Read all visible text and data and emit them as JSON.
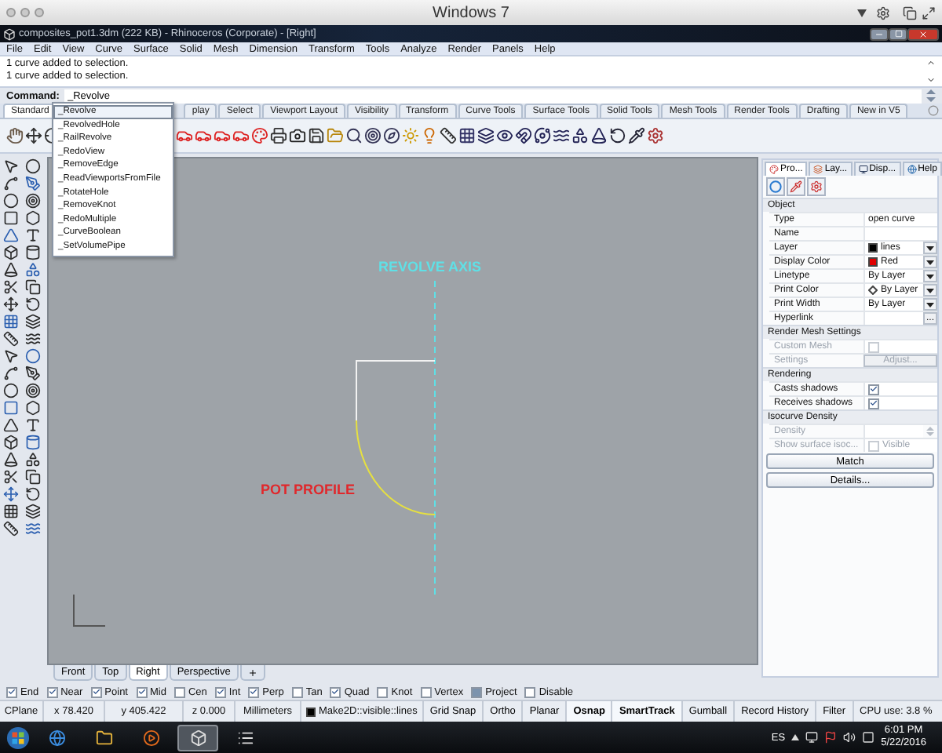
{
  "os_title": "Windows 7",
  "window": {
    "title": "composites_pot1.3dm (222 KB) - Rhinoceros (Corporate) - [Right]"
  },
  "menu": [
    "File",
    "Edit",
    "View",
    "Curve",
    "Surface",
    "Solid",
    "Mesh",
    "Dimension",
    "Transform",
    "Tools",
    "Analyze",
    "Render",
    "Panels",
    "Help"
  ],
  "history": [
    "1 curve added to selection.",
    "1 curve added to selection."
  ],
  "command": {
    "label": "Command:",
    "value": "_Revolve"
  },
  "autocomplete": [
    {
      "label": "_Revolve",
      "selected": true
    },
    {
      "label": "_RevolvedHole",
      "selected": false
    },
    {
      "label": "_RailRevolve",
      "selected": false
    },
    {
      "label": "_RedoView",
      "selected": false
    },
    {
      "label": "_RemoveEdge",
      "selected": false
    },
    {
      "label": "_ReadViewportsFromFile",
      "selected": false
    },
    {
      "label": "_RotateHole",
      "selected": false
    },
    {
      "label": "_RemoveKnot",
      "selected": false
    },
    {
      "label": "_RedoMultiple",
      "selected": false
    },
    {
      "label": "_CurveBoolean",
      "selected": false
    },
    {
      "label": "_SetVolumePipe",
      "selected": false
    }
  ],
  "toolbar_tabs": [
    {
      "label": "Standard",
      "selected": true
    },
    {
      "label": "play",
      "selected": false
    },
    {
      "label": "Select",
      "selected": false
    },
    {
      "label": "Viewport Layout",
      "selected": false
    },
    {
      "label": "Visibility",
      "selected": false
    },
    {
      "label": "Transform",
      "selected": false
    },
    {
      "label": "Curve Tools",
      "selected": false
    },
    {
      "label": "Surface Tools",
      "selected": false
    },
    {
      "label": "Solid Tools",
      "selected": false
    },
    {
      "label": "Mesh Tools",
      "selected": false
    },
    {
      "label": "Render Tools",
      "selected": false
    },
    {
      "label": "Drafting",
      "selected": false
    },
    {
      "label": "New in V5",
      "selected": false
    }
  ],
  "viewport": {
    "axis_label": "REVOLVE AXIS",
    "profile_label": "POT PROFILE"
  },
  "viewport_tabs": [
    {
      "label": "Front",
      "selected": false
    },
    {
      "label": "Top",
      "selected": false
    },
    {
      "label": "Right",
      "selected": true
    },
    {
      "label": "Perspective",
      "selected": false
    }
  ],
  "osnaps": [
    {
      "label": "End",
      "checked": true
    },
    {
      "label": "Near",
      "checked": true
    },
    {
      "label": "Point",
      "checked": true
    },
    {
      "label": "Mid",
      "checked": true
    },
    {
      "label": "Cen",
      "checked": false
    },
    {
      "label": "Int",
      "checked": true
    },
    {
      "label": "Perp",
      "checked": true
    },
    {
      "label": "Tan",
      "checked": false
    },
    {
      "label": "Quad",
      "checked": true
    },
    {
      "label": "Knot",
      "checked": false
    },
    {
      "label": "Vertex",
      "checked": false
    },
    {
      "label": "Project",
      "checked": false,
      "filled": true
    },
    {
      "label": "Disable",
      "checked": false
    }
  ],
  "status": {
    "cplane": "CPlane",
    "x": "x 78.420",
    "y": "y 405.422",
    "z": "z 0.000",
    "units": "Millimeters",
    "layer": "Make2D::visible::lines",
    "toggles": [
      {
        "label": "Grid Snap",
        "on": false
      },
      {
        "label": "Ortho",
        "on": false
      },
      {
        "label": "Planar",
        "on": false
      },
      {
        "label": "Osnap",
        "on": true
      },
      {
        "label": "SmartTrack",
        "on": true
      },
      {
        "label": "Gumball",
        "on": false
      },
      {
        "label": "Record History",
        "on": false
      },
      {
        "label": "Filter",
        "on": false
      }
    ],
    "cpu": "CPU use: 3.8 %"
  },
  "properties": {
    "tabs": [
      {
        "label": "Pro...",
        "selected": true
      },
      {
        "label": "Lay...",
        "selected": false
      },
      {
        "label": "Disp...",
        "selected": false
      },
      {
        "label": "Help",
        "selected": false
      }
    ],
    "sections": [
      {
        "title": "Object",
        "rows": [
          {
            "kind": "text",
            "label": "Type",
            "value": "open curve"
          },
          {
            "kind": "text",
            "label": "Name"
          },
          {
            "kind": "select",
            "label": "Layer",
            "value": "lines",
            "color": "#000000"
          },
          {
            "kind": "select",
            "label": "Display Color",
            "value": "Red",
            "color": "#e00000"
          },
          {
            "kind": "select",
            "label": "Linetype",
            "value": "By Layer"
          },
          {
            "kind": "select",
            "label": "Print Color",
            "value": "By Layer",
            "diamond": true
          },
          {
            "kind": "select",
            "label": "Print Width",
            "value": "By Layer"
          },
          {
            "kind": "dots",
            "label": "Hyperlink",
            "button": "..."
          }
        ]
      },
      {
        "title": "Render Mesh Settings",
        "rows": [
          {
            "kind": "check",
            "label": "Custom Mesh",
            "checked": false,
            "disabled": true
          },
          {
            "kind": "button",
            "label": "Settings",
            "button": "Adjust...",
            "disabled": true
          }
        ]
      },
      {
        "title": "Rendering",
        "rows": [
          {
            "kind": "check",
            "label": "Casts shadows",
            "checked": true,
            "disabled": false
          },
          {
            "kind": "check",
            "label": "Receives shadows",
            "checked": true,
            "disabled": false
          }
        ]
      },
      {
        "title": "Isocurve Density",
        "rows": [
          {
            "kind": "spin",
            "label": "Density",
            "disabled": true
          },
          {
            "kind": "check",
            "label": "Show surface isoc...",
            "checked": false,
            "disabled": true,
            "text": "Visible"
          }
        ]
      }
    ],
    "buttons": [
      "Match",
      "Details..."
    ]
  },
  "taskbar": {
    "apps": [
      {
        "kind": "browser",
        "selected": false
      },
      {
        "kind": "folder",
        "selected": false
      },
      {
        "kind": "media",
        "selected": false
      },
      {
        "kind": "cad",
        "selected": true
      },
      {
        "kind": "list",
        "selected": false
      }
    ],
    "language": "ES",
    "time": "6:01 PM",
    "date": "5/22/2016"
  }
}
